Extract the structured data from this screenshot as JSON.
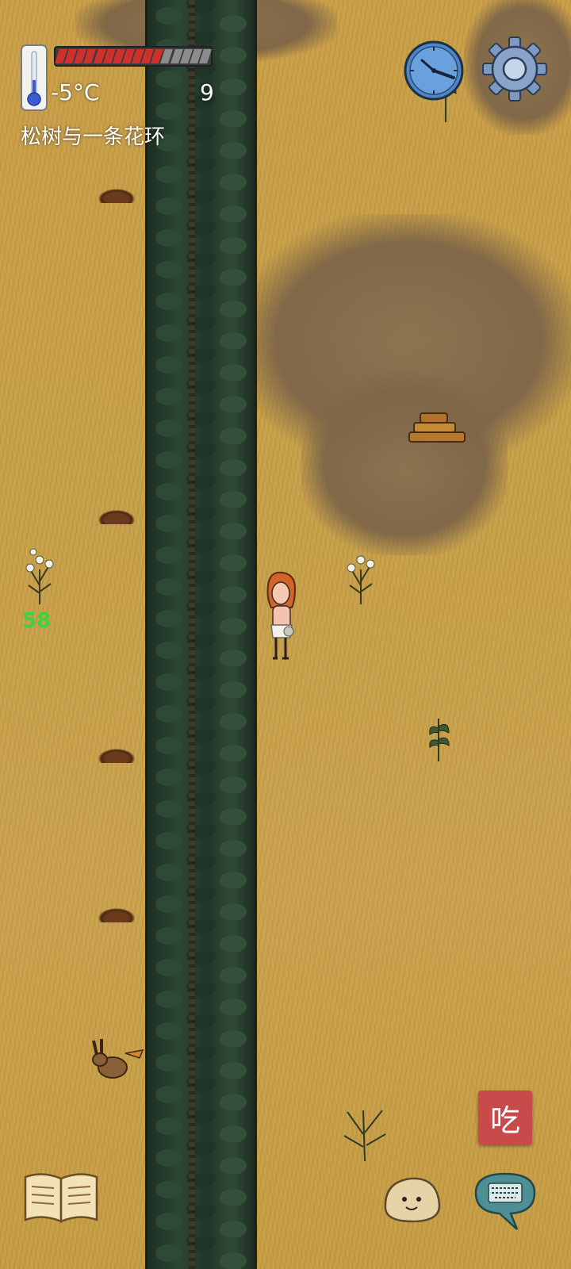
{
  "hud": {
    "temperature": "-5°C",
    "food_count": "9",
    "food_pips_total": 16,
    "food_pips_filled": 11,
    "hovered_object": "松树与一条花环",
    "heat_value": "58"
  },
  "buttons": {
    "eat_label": "吃"
  },
  "icons": [
    "thermometer-icon",
    "clock-icon",
    "settings-gear-icon",
    "recipe-book-icon",
    "emote-face-icon",
    "keyboard-chat-icon"
  ],
  "colors": {
    "grass": "#c9a045",
    "pine": "#2c4634",
    "food_full": "#d0302c",
    "food_empty": "#8c8c8c",
    "heat_number": "#3fd13f",
    "eat_button": "#c94a4a"
  }
}
